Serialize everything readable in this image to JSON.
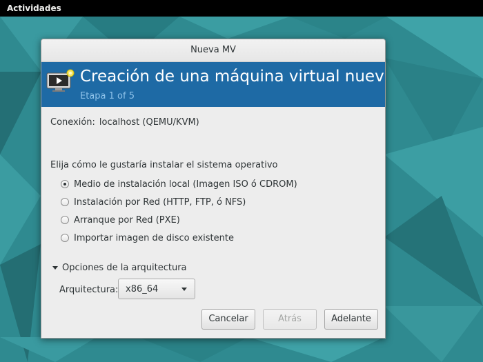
{
  "topbar": {
    "activities_label": "Actividades"
  },
  "dialog": {
    "window_title": "Nueva MV",
    "banner": {
      "title": "Creación de una máquina virtual nueva",
      "step": "Etapa 1 of 5",
      "icon": "monitor-new-icon"
    },
    "connection": {
      "label": "Conexión:",
      "value": "localhost (QEMU/KVM)"
    },
    "install_question": "Elija cómo le gustaría instalar el sistema operativo",
    "install_options": [
      {
        "label": "Medio de instalación local (Imagen ISO ó CDROM)",
        "selected": true
      },
      {
        "label": "Instalación por Red (HTTP, FTP, ó NFS)",
        "selected": false
      },
      {
        "label": "Arranque por Red (PXE)",
        "selected": false
      },
      {
        "label": "Importar imagen de disco existente",
        "selected": false
      }
    ],
    "architecture": {
      "expander_label": "Opciones de la arquitectura",
      "label": "Arquitectura:",
      "selected": "x86_64"
    },
    "buttons": {
      "cancel": "Cancelar",
      "back": "Atrás",
      "forward": "Adelante"
    }
  }
}
